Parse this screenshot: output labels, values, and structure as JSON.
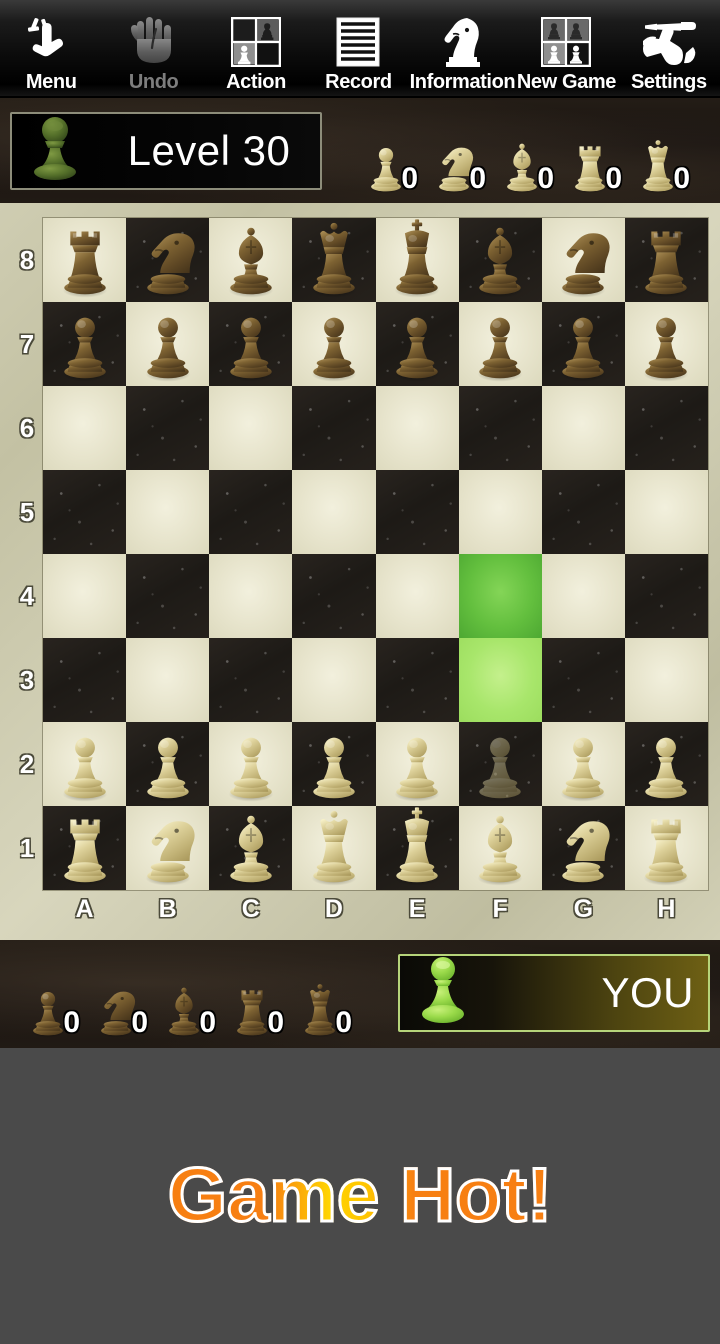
{
  "toolbar": {
    "items": [
      {
        "label": "Menu",
        "icon": "hand-tap-icon",
        "name": "toolbar-menu",
        "enabled": true
      },
      {
        "label": "Undo",
        "icon": "hand-stop-icon",
        "name": "toolbar-undo",
        "enabled": false
      },
      {
        "label": "Action",
        "icon": "board-grid-icon",
        "name": "toolbar-action",
        "enabled": true
      },
      {
        "label": "Record",
        "icon": "document-lines-icon",
        "name": "toolbar-record",
        "enabled": true
      },
      {
        "label": "Information",
        "icon": "knight-head-icon",
        "name": "toolbar-information",
        "enabled": true
      },
      {
        "label": "New Game",
        "icon": "new-game-grid-icon",
        "name": "toolbar-new-game",
        "enabled": true
      },
      {
        "label": "Settings",
        "icon": "wrench-screwdriver-icon",
        "name": "toolbar-settings",
        "enabled": true
      }
    ]
  },
  "opponent": {
    "label": "Level 30",
    "avatar": "green-pawn-avatar",
    "captured": [
      {
        "piece": "pawn",
        "count": "0"
      },
      {
        "piece": "knight",
        "count": "0"
      },
      {
        "piece": "bishop",
        "count": "0"
      },
      {
        "piece": "rook",
        "count": "0"
      },
      {
        "piece": "queen",
        "count": "0"
      }
    ]
  },
  "player": {
    "label": "YOU",
    "avatar": "green-pawn-avatar",
    "captured": [
      {
        "piece": "pawn",
        "count": "0"
      },
      {
        "piece": "knight",
        "count": "0"
      },
      {
        "piece": "bishop",
        "count": "0"
      },
      {
        "piece": "rook",
        "count": "0"
      },
      {
        "piece": "queen",
        "count": "0"
      }
    ]
  },
  "board": {
    "files": [
      "A",
      "B",
      "C",
      "D",
      "E",
      "F",
      "G",
      "H"
    ],
    "ranks": [
      "8",
      "7",
      "6",
      "5",
      "4",
      "3",
      "2",
      "1"
    ],
    "light_square_color": "#e7e4cc",
    "dark_square_color": "#241f1a",
    "highlight_dark_color": "#63bf3e",
    "highlight_light_color": "#a8e66b",
    "highlighted_squares": [
      "F4",
      "F3"
    ],
    "selected_square": "F2",
    "position": [
      [
        "r",
        "n",
        "b",
        "q",
        "k",
        "b",
        "n",
        "r"
      ],
      [
        "p",
        "p",
        "p",
        "p",
        "p",
        "p",
        "p",
        "p"
      ],
      [
        "",
        "",
        "",
        "",
        "",
        "",
        "",
        ""
      ],
      [
        "",
        "",
        "",
        "",
        "",
        "",
        "",
        ""
      ],
      [
        "",
        "",
        "",
        "",
        "",
        "",
        "",
        ""
      ],
      [
        "",
        "",
        "",
        "",
        "",
        "",
        "",
        ""
      ],
      [
        "P",
        "P",
        "P",
        "P",
        "P",
        "P",
        "P",
        "P"
      ],
      [
        "R",
        "N",
        "B",
        "Q",
        "K",
        "B",
        "N",
        "R"
      ]
    ]
  },
  "banner": {
    "text": "Game Hot!",
    "color_primary": "#f77f12",
    "color_accent": "#ffd400",
    "outline_color": "#ffffff"
  }
}
